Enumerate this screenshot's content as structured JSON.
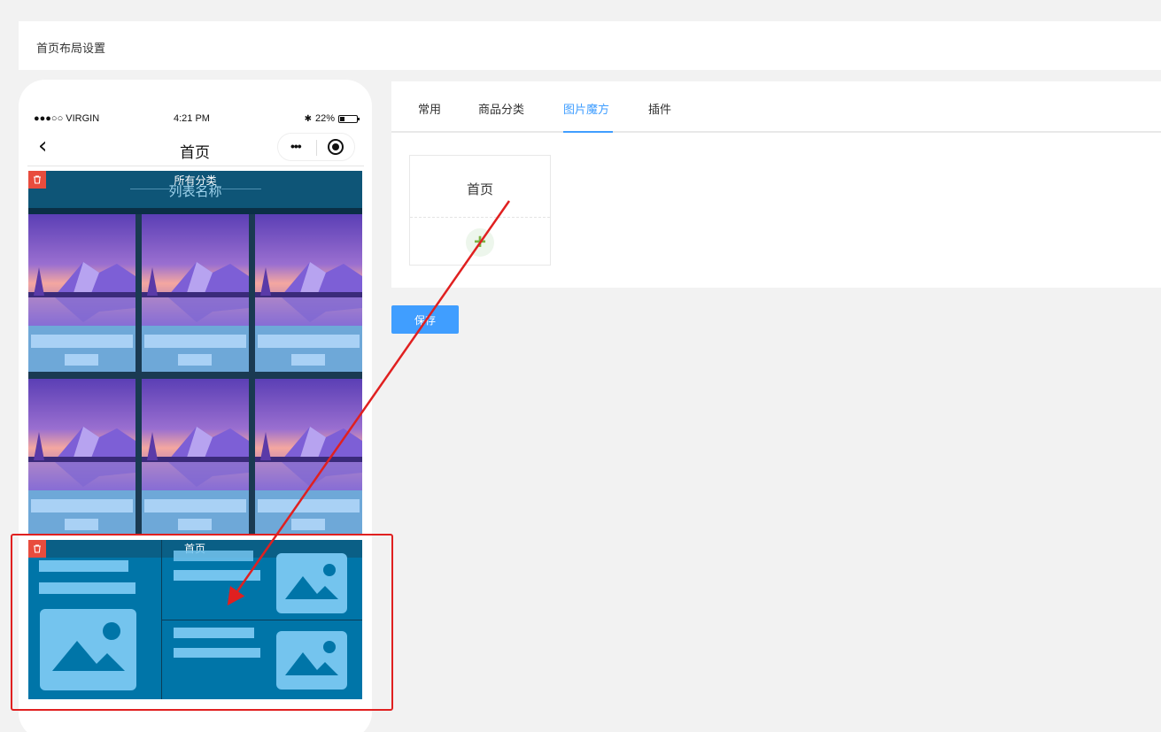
{
  "header": {
    "title": "首页布局设置"
  },
  "phone": {
    "status": {
      "carrier": "●●●○○ VIRGIN",
      "time": "4:21 PM",
      "battery": "22%"
    },
    "nav": {
      "back_icon": "‹",
      "title": "首页",
      "more_icon": "•••"
    },
    "category_module": {
      "name": "所有分类",
      "list_title": "列表名称"
    },
    "cube_module": {
      "name": "首页"
    }
  },
  "panel": {
    "tabs": [
      {
        "label": "常用"
      },
      {
        "label": "商品分类"
      },
      {
        "label": "图片魔方"
      },
      {
        "label": "插件"
      }
    ],
    "active_tab": "图片魔方",
    "cube_card": {
      "label": "首页",
      "add_icon": "+"
    }
  },
  "actions": {
    "save_label": "保存"
  },
  "colors": {
    "accent": "#409eff",
    "delete": "#e84c3d",
    "highlight": "#e02020"
  }
}
